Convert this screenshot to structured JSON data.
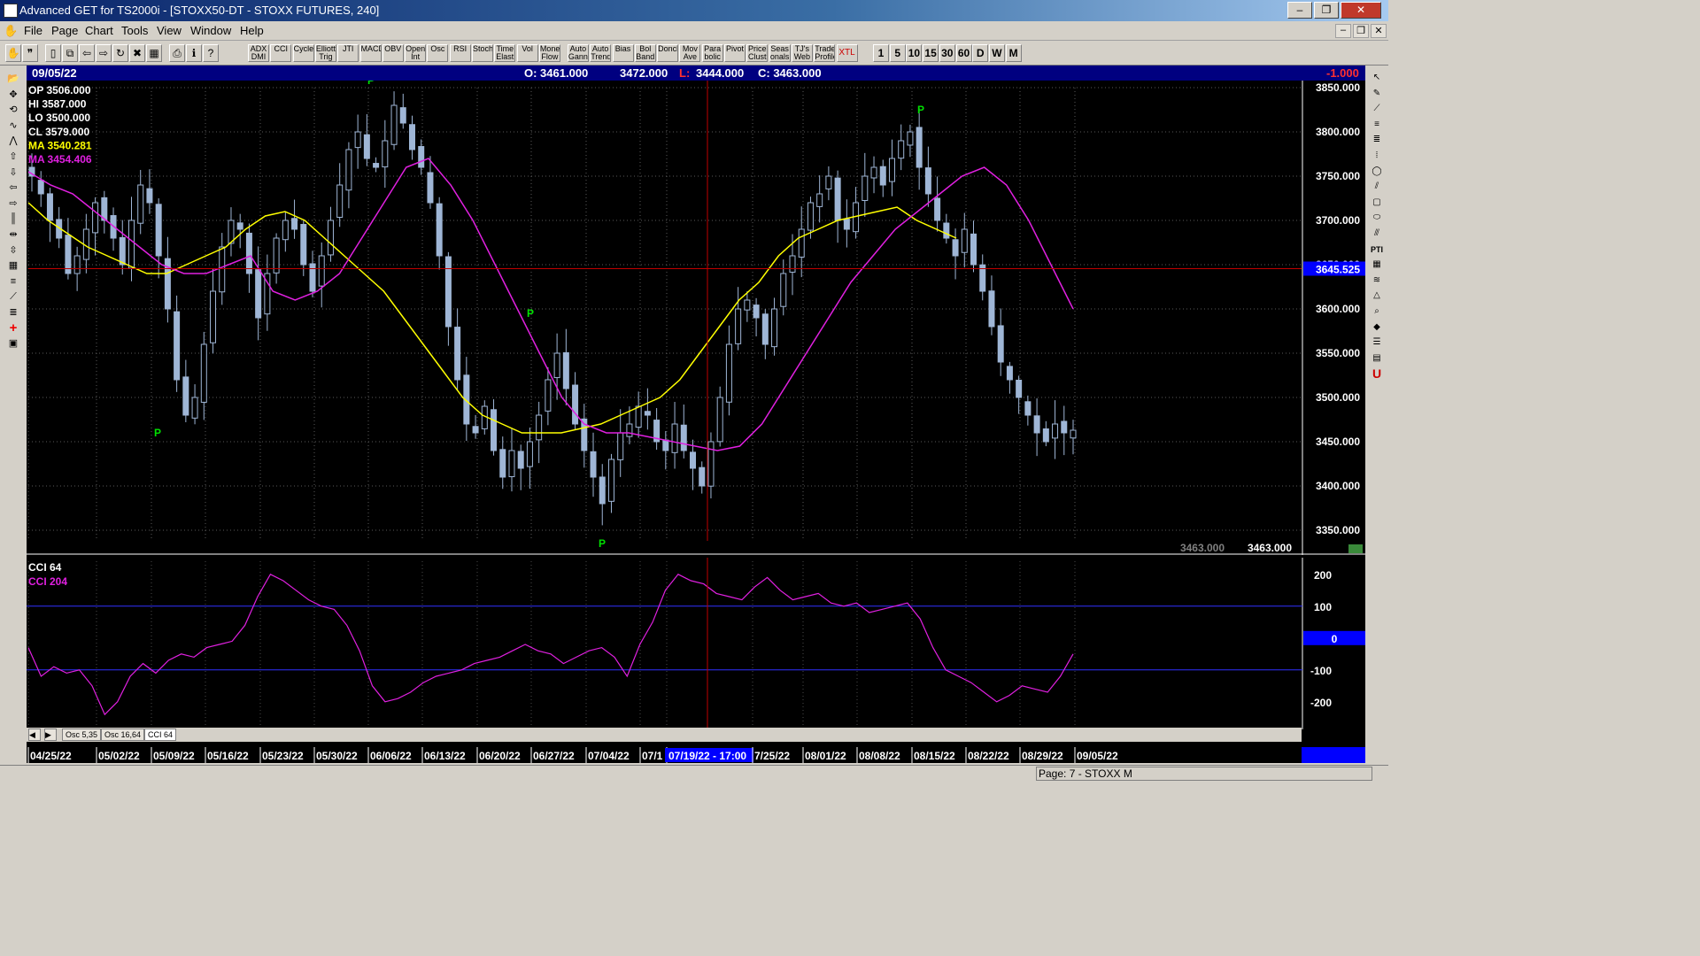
{
  "window": {
    "title": "Advanced GET for TS2000i - [STOXX50-DT - STOXX FUTURES, 240]",
    "minimize": "–",
    "maximize": "❐",
    "close": "✕"
  },
  "menu": {
    "items": [
      "File",
      "Page",
      "Chart",
      "Tools",
      "View",
      "Window",
      "Help"
    ],
    "mdi_min": "–",
    "mdi_restore": "❐",
    "mdi_close": "✕"
  },
  "toolbar": {
    "icon_buttons": [
      "hand-icon",
      "quote-icon",
      "new-icon",
      "copy-icon",
      "back-icon",
      "forward-icon",
      "refresh-icon",
      "delete-icon",
      "grid-icon",
      "print-icon",
      "info-icon",
      "help-icon"
    ],
    "study_buttons": [
      "ADX DMI",
      "CCI",
      "Cycles",
      "Elliott Trig",
      "JTI",
      "MACD",
      "OBV",
      "Open Int",
      "Osc",
      "RSI",
      "Stoch",
      "Time Elast",
      "Vol",
      "Money Flow",
      "Auto Gann",
      "Auto Trend",
      "Bias",
      "Bol Band",
      "Donch",
      "Mov Ave",
      "Para bolic",
      "Pivot",
      "Price Clust",
      "Seas onals",
      "TJ's Web",
      "Trade Profile",
      "XTL"
    ],
    "timeframes": [
      "1",
      "5",
      "10",
      "15",
      "30",
      "60",
      "D",
      "W",
      "M"
    ]
  },
  "info": {
    "date": "09/05/22",
    "open": "O: 3461.000",
    "high": "3472.000",
    "low_label": "L:",
    "low": "3444.000",
    "close": "C: 3463.000",
    "change": "-1.000"
  },
  "legend": {
    "op": "OP  3506.000",
    "hi": "HI   3587.000",
    "lo": "LO  3500.000",
    "cl": "CL  3579.000",
    "ma1": "MA  3540.281",
    "ma2": "MA  3454.406"
  },
  "price_axis": {
    "ticks": [
      "3850.000",
      "3800.000",
      "3750.000",
      "3700.000",
      "3650.000",
      "3600.000",
      "3550.000",
      "3500.000",
      "3450.000",
      "3400.000",
      "3350.000"
    ],
    "cursor_price": "3645.525",
    "last_price_grey": "3463.000",
    "last_price_white": "3463.000"
  },
  "osc": {
    "title": "CCI 64",
    "value_label": "CCI  204",
    "ticks": [
      "200",
      "100",
      "0",
      "-100",
      "-200"
    ]
  },
  "tabs": [
    "Osc 5,35",
    "Osc 16,64",
    "CCI 64"
  ],
  "dates": [
    "04/25/22",
    "05/02/22",
    "05/09/22",
    "05/16/22",
    "05/23/22",
    "05/30/22",
    "06/06/22",
    "06/13/22",
    "06/20/22",
    "06/27/22",
    "07/04/22",
    "07/1",
    "07/19/22 - 17:00",
    "7/25/22",
    "08/01/22",
    "08/08/22",
    "08/15/22",
    "08/22/22",
    "08/29/22",
    "09/05/22"
  ],
  "status": {
    "page": "Page: 7 - STOXX M"
  },
  "pivot_label": "P",
  "chart_data": {
    "type": "candlestick",
    "title": "STOXX50-DT - STOXX FUTURES, 240",
    "ylim": [
      3330,
      3860
    ],
    "pivots": [
      {
        "label": "P",
        "date": "05/10/22",
        "price": 3470,
        "position": "below"
      },
      {
        "label": "P",
        "date": "06/03/22",
        "price": 3848,
        "position": "above"
      },
      {
        "label": "P",
        "date": "06/24/22",
        "price": 3585,
        "position": "above"
      },
      {
        "label": "P",
        "date": "07/06/22",
        "price": 3345,
        "position": "below"
      },
      {
        "label": "P",
        "date": "08/17/22",
        "price": 3815,
        "position": "above"
      }
    ],
    "close_path": [
      3750,
      3730,
      3700,
      3680,
      3640,
      3660,
      3690,
      3720,
      3700,
      3680,
      3650,
      3700,
      3740,
      3720,
      3660,
      3600,
      3520,
      3480,
      3500,
      3560,
      3620,
      3670,
      3700,
      3690,
      3640,
      3590,
      3640,
      3680,
      3700,
      3690,
      3650,
      3620,
      3660,
      3700,
      3740,
      3780,
      3800,
      3770,
      3760,
      3790,
      3830,
      3810,
      3780,
      3760,
      3720,
      3660,
      3580,
      3520,
      3470,
      3460,
      3490,
      3440,
      3410,
      3440,
      3420,
      3450,
      3480,
      3520,
      3550,
      3510,
      3470,
      3440,
      3410,
      3380,
      3430,
      3460,
      3470,
      3490,
      3480,
      3450,
      3440,
      3470,
      3440,
      3420,
      3400,
      3450,
      3500,
      3560,
      3600,
      3610,
      3590,
      3560,
      3600,
      3640,
      3660,
      3690,
      3720,
      3730,
      3750,
      3700,
      3690,
      3720,
      3750,
      3760,
      3740,
      3770,
      3790,
      3800,
      3760,
      3730,
      3700,
      3680,
      3660,
      3690,
      3650,
      3620,
      3580,
      3540,
      3520,
      3500,
      3480,
      3460,
      3450,
      3470,
      3460,
      3463
    ],
    "ma_short": [
      3720,
      3700,
      3685,
      3670,
      3660,
      3650,
      3640,
      3640,
      3650,
      3660,
      3670,
      3690,
      3705,
      3710,
      3700,
      3680,
      3660,
      3640,
      3620,
      3590,
      3560,
      3530,
      3500,
      3480,
      3470,
      3460,
      3460,
      3460,
      3465,
      3470,
      3480,
      3490,
      3500,
      3520,
      3550,
      3580,
      3610,
      3630,
      3660,
      3680,
      3690,
      3700,
      3705,
      3710,
      3715,
      3700,
      3690,
      3680
    ],
    "ma_long": [
      3755,
      3740,
      3730,
      3710,
      3690,
      3670,
      3650,
      3640,
      3640,
      3650,
      3660,
      3620,
      3610,
      3620,
      3640,
      3680,
      3720,
      3760,
      3770,
      3740,
      3700,
      3650,
      3600,
      3550,
      3500,
      3470,
      3460,
      3460,
      3455,
      3450,
      3445,
      3440,
      3445,
      3470,
      3510,
      3550,
      3590,
      3630,
      3660,
      3690,
      3710,
      3730,
      3750,
      3760,
      3740,
      3700,
      3650,
      3600
    ],
    "cci": [
      -30,
      -120,
      -90,
      -110,
      -100,
      -150,
      -240,
      -200,
      -120,
      -80,
      -110,
      -70,
      -50,
      -60,
      -30,
      -20,
      -10,
      40,
      130,
      200,
      180,
      150,
      120,
      100,
      90,
      40,
      -40,
      -150,
      -200,
      -190,
      -170,
      -140,
      -120,
      -110,
      -100,
      -80,
      -70,
      -60,
      -40,
      -20,
      -40,
      -50,
      -80,
      -60,
      -40,
      -30,
      -60,
      -120,
      -20,
      50,
      150,
      200,
      180,
      170,
      140,
      130,
      120,
      160,
      190,
      150,
      120,
      130,
      140,
      110,
      100,
      110,
      80,
      90,
      100,
      110,
      60,
      -30,
      -100,
      -120,
      -140,
      -170,
      -200,
      -180,
      -150,
      -160,
      -170,
      -120,
      -50
    ],
    "cci_ylim": [
      -270,
      230
    ]
  }
}
